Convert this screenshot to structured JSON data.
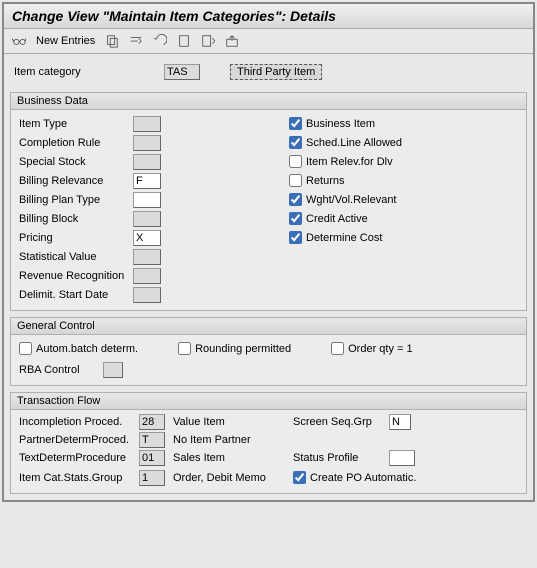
{
  "title": "Change View \"Maintain Item Categories\": Details",
  "toolbar": {
    "new_entries": "New Entries"
  },
  "header": {
    "item_category_label": "Item category",
    "item_category": "TAS",
    "item_category_desc": "Third Party Item"
  },
  "business_data": {
    "title": "Business Data",
    "left": {
      "item_type_label": "Item Type",
      "item_type": "",
      "completion_rule_label": "Completion Rule",
      "completion_rule": "",
      "special_stock_label": "Special Stock",
      "special_stock": "",
      "billing_relevance_label": "Billing Relevance",
      "billing_relevance": "F",
      "billing_plan_type_label": "Billing Plan Type",
      "billing_plan_type": "",
      "billing_block_label": "Billing Block",
      "billing_block": "",
      "pricing_label": "Pricing",
      "pricing": "X",
      "statistical_value_label": "Statistical Value",
      "statistical_value": "",
      "revenue_recognition_label": "Revenue Recognition",
      "revenue_recognition": "",
      "delimit_start_label": "Delimit. Start Date",
      "delimit_start": ""
    },
    "right": {
      "business_item": "Business Item",
      "sched_line": "Sched.Line Allowed",
      "item_relev": "Item Relev.for Dlv",
      "returns": "Returns",
      "wght_vol": "Wght/Vol.Relevant",
      "credit_active": "Credit Active",
      "determine_cost": "Determine Cost"
    }
  },
  "general_control": {
    "title": "General Control",
    "autom_batch": "Autom.batch determ.",
    "rounding": "Rounding permitted",
    "order_qty": "Order qty = 1",
    "rba_label": "RBA Control",
    "rba": ""
  },
  "transaction_flow": {
    "title": "Transaction Flow",
    "incompletion_label": "Incompletion Proced.",
    "incompletion": "28",
    "incompletion_desc": "Value Item",
    "partner_label": "PartnerDetermProced.",
    "partner": "T",
    "partner_desc": "No Item Partner",
    "text_label": "TextDetermProcedure",
    "text": "01",
    "text_desc": "Sales Item",
    "stats_label": "Item Cat.Stats.Group",
    "stats": "1",
    "stats_desc": "Order, Debit Memo",
    "screen_seq_label": "Screen Seq.Grp",
    "screen_seq": "N",
    "status_profile_label": "Status Profile",
    "status_profile": "",
    "create_po": "Create PO Automatic."
  }
}
